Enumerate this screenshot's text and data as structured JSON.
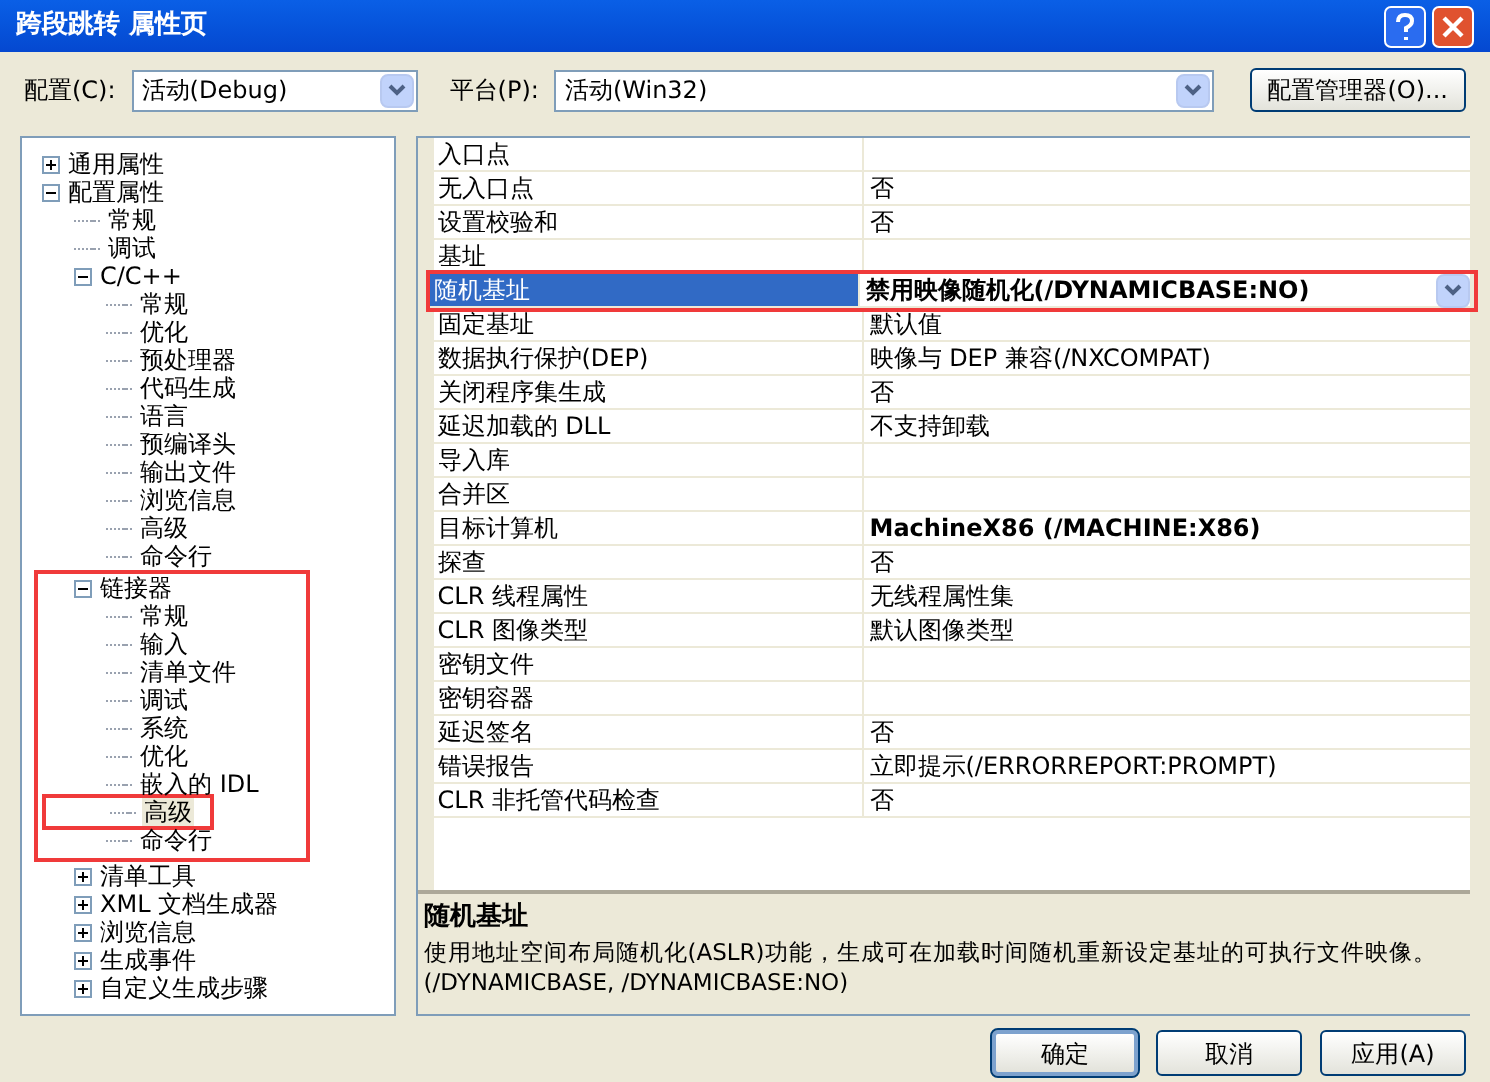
{
  "window": {
    "title": "跨段跳转 属性页"
  },
  "toolbar": {
    "config_label": "配置(C):",
    "config_value": "活动(Debug)",
    "platform_label": "平台(P):",
    "platform_value": "活动(Win32)",
    "manager_button": "配置管理器(O)..."
  },
  "tree": [
    {
      "label": "通用属性",
      "expanded": false,
      "selected": false
    },
    {
      "label": "配置属性",
      "expanded": true,
      "selected": false,
      "children": [
        {
          "label": "常规",
          "selected": false
        },
        {
          "label": "调试",
          "selected": false
        },
        {
          "label": "C/C++",
          "expanded": true,
          "selected": false,
          "children": [
            {
              "label": "常规",
              "selected": false
            },
            {
              "label": "优化",
              "selected": false
            },
            {
              "label": "预处理器",
              "selected": false
            },
            {
              "label": "代码生成",
              "selected": false
            },
            {
              "label": "语言",
              "selected": false
            },
            {
              "label": "预编译头",
              "selected": false
            },
            {
              "label": "输出文件",
              "selected": false
            },
            {
              "label": "浏览信息",
              "selected": false
            },
            {
              "label": "高级",
              "selected": false
            },
            {
              "label": "命令行",
              "selected": false
            }
          ]
        },
        {
          "label": "链接器",
          "expanded": true,
          "selected": false,
          "annotated": true,
          "children": [
            {
              "label": "常规",
              "selected": false
            },
            {
              "label": "输入",
              "selected": false
            },
            {
              "label": "清单文件",
              "selected": false
            },
            {
              "label": "调试",
              "selected": false
            },
            {
              "label": "系统",
              "selected": false
            },
            {
              "label": "优化",
              "selected": false
            },
            {
              "label": "嵌入的 IDL",
              "selected": false
            },
            {
              "label": "高级",
              "selected": true,
              "annotated": true
            },
            {
              "label": "命令行",
              "selected": false
            }
          ]
        },
        {
          "label": "清单工具",
          "expanded": false,
          "selected": false
        },
        {
          "label": "XML 文档生成器",
          "expanded": false,
          "selected": false
        },
        {
          "label": "浏览信息",
          "expanded": false,
          "selected": false
        },
        {
          "label": "生成事件",
          "expanded": false,
          "selected": false
        },
        {
          "label": "自定义生成步骤",
          "expanded": false,
          "selected": false
        }
      ]
    }
  ],
  "properties": [
    {
      "name": "入口点",
      "selected": false
    },
    {
      "name": "无入口点",
      "value": "否",
      "modified": false,
      "selected": false
    },
    {
      "name": "设置校验和",
      "value": "否",
      "modified": false,
      "selected": false
    },
    {
      "name": "基址",
      "selected": false
    },
    {
      "name": "随机基址",
      "value": "禁用映像随机化(/DYNAMICBASE:NO)",
      "modified": true,
      "selected": true,
      "annotated": true
    },
    {
      "name": "固定基址",
      "value": "默认值",
      "modified": false,
      "selected": false
    },
    {
      "name": "数据执行保护(DEP)",
      "value": "映像与 DEP 兼容(/NXCOMPAT)",
      "modified": false,
      "selected": false
    },
    {
      "name": "关闭程序集生成",
      "value": "否",
      "modified": false,
      "selected": false
    },
    {
      "name": "延迟加载的 DLL",
      "value": "不支持卸载",
      "modified": false,
      "selected": false
    },
    {
      "name": "导入库",
      "selected": false
    },
    {
      "name": "合并区",
      "selected": false
    },
    {
      "name": "目标计算机",
      "value": "MachineX86 (/MACHINE:X86)",
      "modified": true,
      "selected": false
    },
    {
      "name": "探查",
      "value": "否",
      "modified": false,
      "selected": false
    },
    {
      "name": "CLR 线程属性",
      "value": "无线程属性集",
      "modified": false,
      "selected": false
    },
    {
      "name": "CLR 图像类型",
      "value": "默认图像类型",
      "modified": false,
      "selected": false
    },
    {
      "name": "密钥文件",
      "selected": false
    },
    {
      "name": "密钥容器",
      "selected": false
    },
    {
      "name": "延迟签名",
      "value": "否",
      "modified": false,
      "selected": false
    },
    {
      "name": "错误报告",
      "value": "立即提示(/ERRORREPORT:PROMPT)",
      "modified": false,
      "selected": false
    },
    {
      "name": "CLR 非托管代码检查",
      "value": "否",
      "modified": false,
      "selected": false
    }
  ],
  "description": {
    "title": "随机基址",
    "text": "使用地址空间布局随机化(ASLR)功能，生成可在加载时间随机重新设定基址的可执行文件映像。(/DYNAMICBASE, /DYNAMICBASE:NO)"
  },
  "buttons": [
    {
      "label": "确定",
      "default": true
    },
    {
      "label": "取消",
      "default": false
    },
    {
      "label": "应用(A)",
      "default": false
    }
  ]
}
